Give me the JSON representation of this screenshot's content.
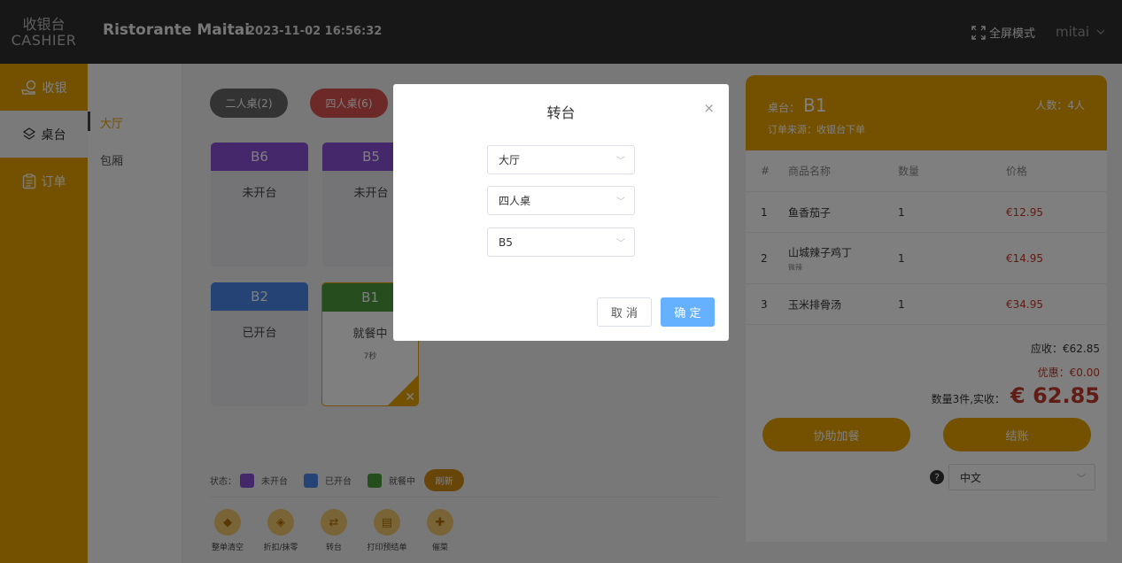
{
  "header": {
    "brand_line1": "收银台",
    "brand_line2": "CASHIER",
    "shop_name": "Ristorante Maitai",
    "datetime": "2023-11-02 16:56:32",
    "fullscreen_label": "全屏模式",
    "username": "mitai",
    "bg_color": "#2f2f2f"
  },
  "nav": {
    "accent": "#e6a200",
    "items": [
      {
        "label": "收银",
        "icon": "cashier-icon"
      },
      {
        "label": "桌台",
        "icon": "table-icon",
        "active": true
      },
      {
        "label": "订单",
        "icon": "clipboard-icon"
      }
    ]
  },
  "subnav": {
    "items": [
      {
        "label": "大厅",
        "active": true
      },
      {
        "label": "包厢"
      }
    ]
  },
  "main": {
    "filters": [
      {
        "label": "二人桌(2)",
        "color": "#666666"
      },
      {
        "label": "四人桌(6)",
        "color": "#d9534f"
      }
    ],
    "tables": [
      {
        "name": "B6",
        "status": "未开台",
        "color": "#8a4fd6"
      },
      {
        "name": "B5",
        "status": "未开台",
        "color": "#8a4fd6"
      },
      {
        "name": "B2",
        "status": "已开台",
        "color": "#4a86e8"
      },
      {
        "name": "B1",
        "status": "就餐中",
        "time": "7秒",
        "color": "#4c9a3a",
        "selected": true
      }
    ],
    "legend": {
      "prefix": "状态：",
      "items": [
        {
          "label": "未开台",
          "color": "#8a4fd6"
        },
        {
          "label": "已开台",
          "color": "#4a86e8"
        },
        {
          "label": "就餐中",
          "color": "#4c9a3a"
        }
      ],
      "refresh_label": "刷新"
    },
    "actions": [
      {
        "label": "整单清空",
        "icon": "clear-icon"
      },
      {
        "label": "折扣/抹零",
        "icon": "discount-icon"
      },
      {
        "label": "转台",
        "icon": "transfer-icon"
      },
      {
        "label": "打印预结单",
        "icon": "print-icon"
      },
      {
        "label": "催菜",
        "icon": "urge-icon"
      }
    ]
  },
  "order": {
    "table_prefix": "桌台：",
    "table_name": "B1",
    "people": "人数：4人",
    "source": "订单来源：收银台下单",
    "columns": [
      "#",
      "商品名称",
      "数量",
      "价格"
    ],
    "rows": [
      {
        "idx": "1",
        "name": "鱼香茄子",
        "qty": "1",
        "price": "€12.95"
      },
      {
        "idx": "2",
        "name": "山城辣子鸡丁",
        "note": "微辣",
        "qty": "1",
        "price": "€14.95"
      },
      {
        "idx": "3",
        "name": "玉米排骨汤",
        "qty": "1",
        "price": "€34.95"
      }
    ],
    "receivable": "应收：€62.85",
    "discount": "优惠：€0.00",
    "paid_label": "数量3件,实收：",
    "paid_total": "€ 62.85",
    "assist_button": "协助加餐",
    "checkout_button": "结账",
    "help_icon": "question-icon",
    "language": "中文"
  },
  "modal": {
    "title": "转台",
    "close": "×",
    "select_area": "大厅",
    "select_type": "四人桌",
    "select_table": "B5",
    "cancel_label": "取 消",
    "confirm_label": "确 定",
    "confirm_color": "#66b1ff"
  }
}
